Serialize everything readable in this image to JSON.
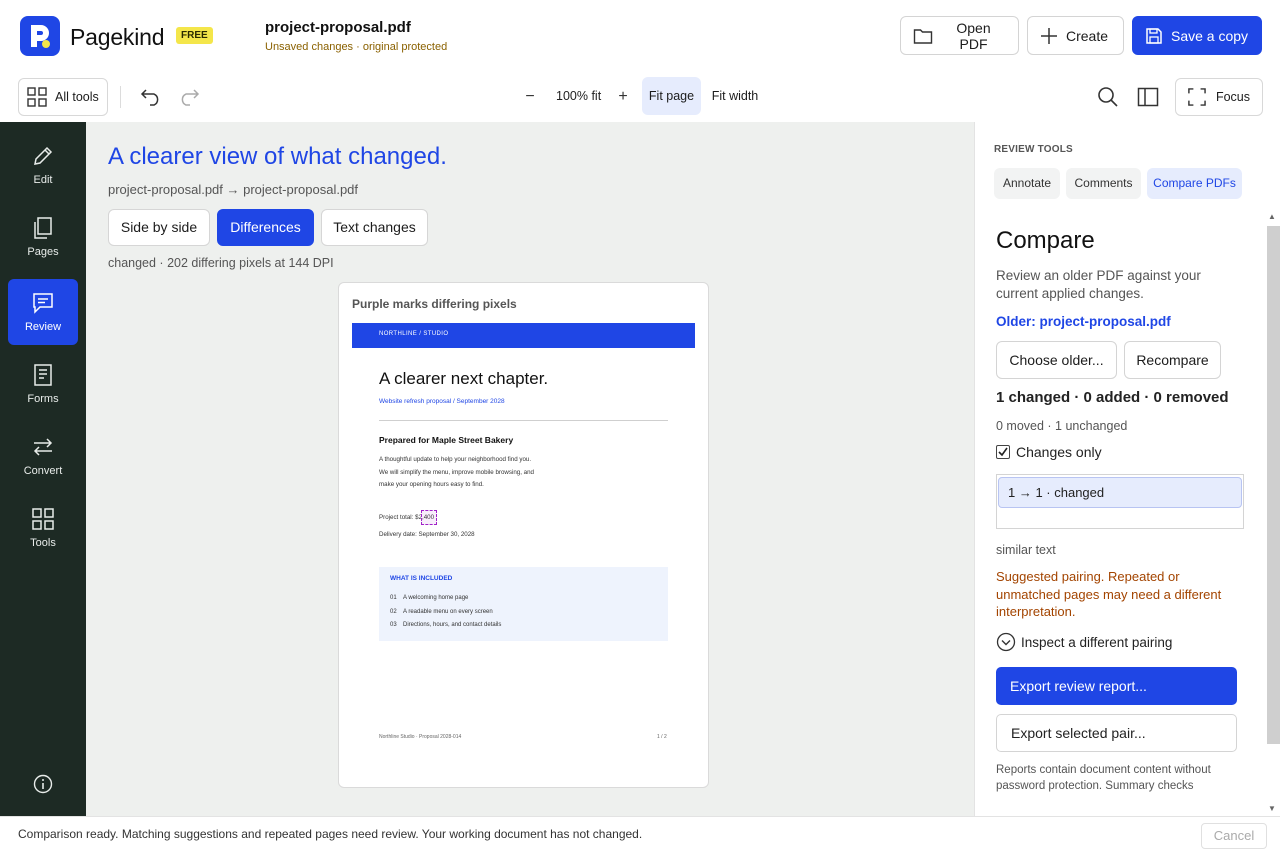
{
  "header": {
    "brand": "Pagekind",
    "plan_badge": "FREE",
    "doc_name": "project-proposal.pdf",
    "doc_status": "Unsaved changes · original protected",
    "open_label": "Open PDF",
    "create_label": "Create",
    "save_label": "Save a copy",
    "brand_color": "#1f46e5"
  },
  "toolbar": {
    "all_tools_label": "All tools",
    "zoom_minus": "−",
    "zoom_value": "100% fit",
    "zoom_plus": "+",
    "fit_page_label": "Fit page",
    "fit_width_label": "Fit width",
    "focus_label": "Focus"
  },
  "rail": {
    "items": [
      {
        "label": "Edit",
        "icon": "pencil-icon"
      },
      {
        "label": "Pages",
        "icon": "pages-icon"
      },
      {
        "label": "Review",
        "icon": "comment-icon",
        "active": true
      },
      {
        "label": "Forms",
        "icon": "form-icon"
      },
      {
        "label": "Convert",
        "icon": "swap-icon"
      },
      {
        "label": "Tools",
        "icon": "grid-icon"
      }
    ]
  },
  "canvas": {
    "title": "A clearer view of what changed.",
    "path": "project-proposal.pdf  →  project-proposal.pdf",
    "modes": [
      "Side by side",
      "Differences",
      "Text changes"
    ],
    "active_mode": "Differences",
    "meta": "changed · 202 differing pixels at 144 DPI",
    "card_label": "Purple marks differing pixels",
    "diff_color": "#a020c8"
  },
  "doc": {
    "band_text": "NORTHLINE  /  STUDIO",
    "heading": "A clearer next chapter.",
    "subtitle": "Website refresh proposal  /  September 2028",
    "prepared": "Prepared for Maple Street Bakery",
    "body_lines": [
      "A thoughtful update to help your neighborhood find you.",
      "We will simplify the menu, improve mobile browsing, and",
      "make your opening hours easy to find."
    ],
    "price_label": "Project total: ",
    "price_value": "$2,400",
    "delivery": "Delivery date: September 30, 2028",
    "included_title": "WHAT IS INCLUDED",
    "included_items": [
      {
        "num": "01",
        "text": "A welcoming home page"
      },
      {
        "num": "02",
        "text": "A readable menu on every screen"
      },
      {
        "num": "03",
        "text": "Directions, hours, and contact details"
      }
    ],
    "footer_left": "Northline Studio  ·  Proposal 2028-014",
    "footer_right": "1 / 2"
  },
  "panel": {
    "heading": "REVIEW TOOLS",
    "tabs": [
      "Annotate",
      "Comments",
      "Compare PDFs"
    ],
    "active_tab": "Compare PDFs",
    "title": "Compare",
    "description": "Review an older PDF against your current applied changes.",
    "older": "Older: project-proposal.pdf",
    "choose_label": "Choose older...",
    "recompare_label": "Recompare",
    "summary": "1 changed · 0 added · 0 removed",
    "summary2": "0 moved · 1 unchanged",
    "changes_only_label": "Changes only",
    "changes_only_checked": true,
    "list_item": "1 → 1  ·  changed",
    "similarity": "similar text",
    "warning": "Suggested pairing. Repeated or unmatched pages may need a different interpretation.",
    "inspect_label": "Inspect a different pairing",
    "export_report_label": "Export review report...",
    "export_pair_label": "Export selected pair...",
    "note": "Reports contain document content without password protection. Summary checks",
    "warning_color": "#a34400"
  },
  "status": {
    "text": "Comparison ready. Matching suggestions and repeated pages need review. Your working document has not changed.",
    "cancel_label": "Cancel"
  }
}
